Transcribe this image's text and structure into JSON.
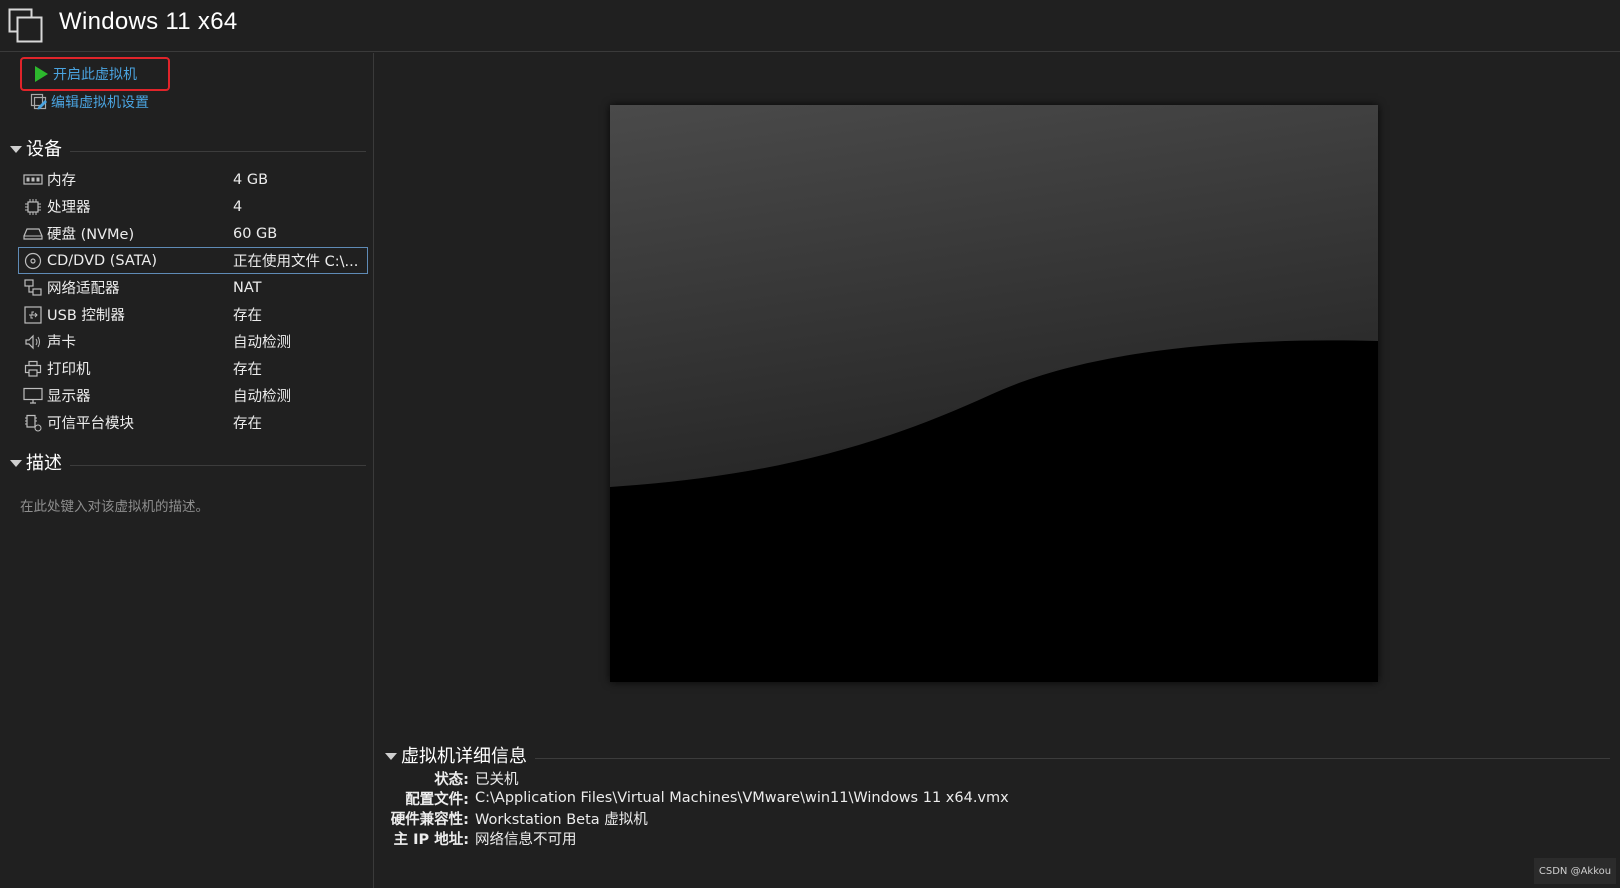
{
  "window": {
    "title": "Windows 11 x64"
  },
  "actions": {
    "start_label": "开启此虚拟机",
    "edit_label": "编辑虚拟机设置"
  },
  "devices": {
    "heading": "设备",
    "items": [
      {
        "icon": "memory-icon",
        "name": "内存",
        "value": "4 GB"
      },
      {
        "icon": "cpu-icon",
        "name": "处理器",
        "value": "4"
      },
      {
        "icon": "hard-disk-icon",
        "name": "硬盘 (NVMe)",
        "value": "60 GB"
      },
      {
        "icon": "cd-dvd-icon",
        "name": "CD/DVD (SATA)",
        "value": "正在使用文件 C:\\...",
        "selected": true
      },
      {
        "icon": "network-adapter-icon",
        "name": "网络适配器",
        "value": "NAT"
      },
      {
        "icon": "usb-icon",
        "name": "USB 控制器",
        "value": "存在"
      },
      {
        "icon": "sound-card-icon",
        "name": "声卡",
        "value": "自动检测"
      },
      {
        "icon": "printer-icon",
        "name": "打印机",
        "value": "存在"
      },
      {
        "icon": "display-icon",
        "name": "显示器",
        "value": "自动检测"
      },
      {
        "icon": "tpm-icon",
        "name": "可信平台模块",
        "value": "存在"
      }
    ]
  },
  "description": {
    "heading": "描述",
    "placeholder": "在此处键入对该虚拟机的描述。"
  },
  "details": {
    "heading": "虚拟机详细信息",
    "rows": [
      {
        "key": "状态:",
        "value": "已关机"
      },
      {
        "key": "配置文件:",
        "value": "C:\\Application Files\\Virtual Machines\\VMware\\win11\\Windows 11 x64.vmx"
      },
      {
        "key": "硬件兼容性:",
        "value": "Workstation Beta 虚拟机"
      },
      {
        "key": "主 IP 地址:",
        "value": "网络信息不可用"
      }
    ]
  },
  "watermark": "CSDN @Akkou",
  "colors": {
    "background": "#202020",
    "link": "#4aa3df",
    "highlight_border": "#e0242a",
    "play_green": "#2db82d",
    "selected_border": "#5f8bb6"
  }
}
